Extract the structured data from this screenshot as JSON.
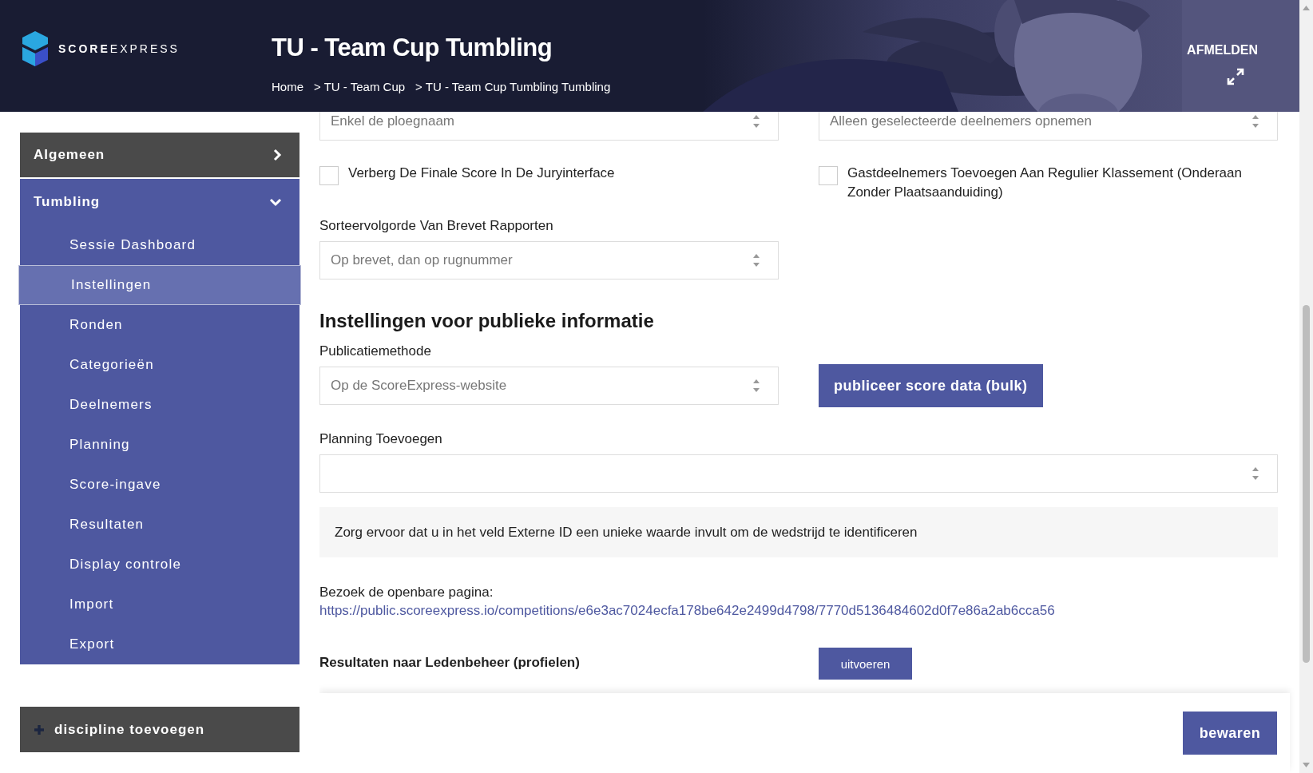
{
  "header": {
    "brand": {
      "strong": "SCORE",
      "light": "EXPRESS"
    },
    "title": "TU - Team Cup Tumbling",
    "breadcrumbs": [
      "Home",
      "> TU - Team Cup",
      "> TU - Team Cup Tumbling Tumbling"
    ],
    "logout": "AFMELDEN"
  },
  "sidebar": {
    "sections": [
      {
        "label": "Algemeen",
        "expanded": false
      },
      {
        "label": "Tumbling",
        "expanded": true,
        "items": [
          {
            "label": "Sessie Dashboard",
            "selected": false
          },
          {
            "label": "Instellingen",
            "selected": true
          },
          {
            "label": "Ronden",
            "selected": false
          },
          {
            "label": "Categorieën",
            "selected": false
          },
          {
            "label": "Deelnemers",
            "selected": false
          },
          {
            "label": "Planning",
            "selected": false
          },
          {
            "label": "Score-ingave",
            "selected": false
          },
          {
            "label": "Resultaten",
            "selected": false
          },
          {
            "label": "Display controle",
            "selected": false
          },
          {
            "label": "Import",
            "selected": false
          },
          {
            "label": "Export",
            "selected": false
          }
        ]
      }
    ],
    "add_button": "discipline toevoegen"
  },
  "form": {
    "top_selects": [
      {
        "value": "Enkel de ploegnaam"
      },
      {
        "value": "Alleen geselecteerde deelnemers opnemen"
      }
    ],
    "checkboxes": [
      {
        "label": "Verberg De Finale Score In De Juryinterface",
        "checked": false
      },
      {
        "label": "Gastdeelnemers Toevoegen Aan Regulier Klassement (Onderaan Zonder Plaatsaanduiding)",
        "checked": false
      }
    ],
    "sort_field": {
      "label": "Sorteervolgorde Van Brevet Rapporten",
      "value": "Op brevet, dan op rugnummer"
    }
  },
  "public_section": {
    "heading": "Instellingen voor publieke informatie",
    "method": {
      "label": "Publicatiemethode",
      "value": "Op de ScoreExpress-website"
    },
    "publish_button": "publiceer score data (bulk)",
    "planning": {
      "label": "Planning Toevoegen"
    },
    "notice": "Zorg ervoor dat u in het veld Externe ID een unieke waarde invult om de wedstrijd te identificeren",
    "visit_label": "Bezoek de openbare pagina:",
    "link": "https://public.scoreexpress.io/competitions/e6e3ac7024ecfa178be642e2499d4798/7770d5136484602d0f7e86a2ab6cca56",
    "actions": [
      {
        "label": "Resultaten naar Ledenbeheer (profielen)",
        "kind": "button-row",
        "button": "uitvoeren"
      }
    ]
  },
  "footer": {
    "save_button": "bewaren"
  }
}
